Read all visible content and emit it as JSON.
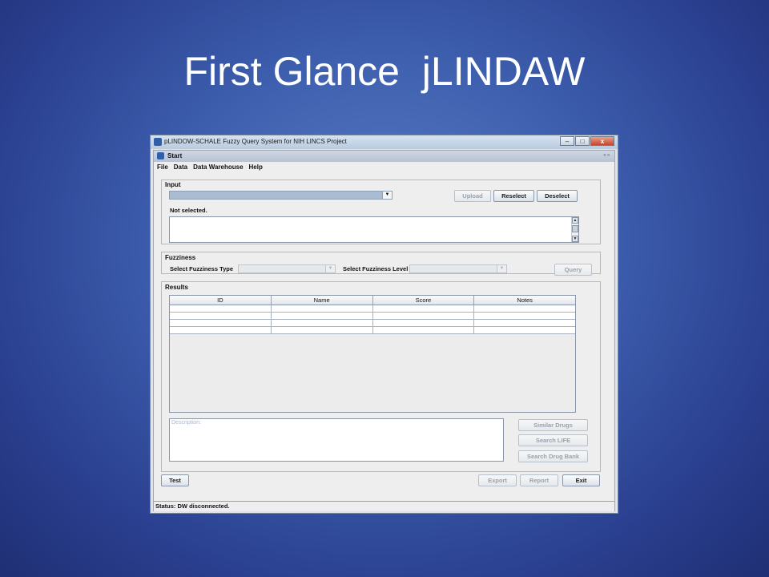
{
  "slide": {
    "title": "First Glance  jLINDAW"
  },
  "window": {
    "title": "pLINDOW-SCHALE Fuzzy Query System for NIH LINCS Project",
    "controls": {
      "minimize": "–",
      "maximize": "□",
      "close": "x"
    }
  },
  "internal_frame": {
    "title": "Start",
    "controls": "▫▫"
  },
  "menu": {
    "items": [
      "File",
      "Data",
      "Data Warehouse",
      "Help"
    ]
  },
  "input_panel": {
    "title": "Input",
    "combo_value": "",
    "status": "Not selected.",
    "buttons": {
      "upload": "Upload",
      "reselect": "Reselect",
      "deselect": "Deselect"
    }
  },
  "fuzziness_panel": {
    "title": "Fuzziness",
    "type_label": "Select Fuzziness Type",
    "level_label": "Select Fuzziness Level",
    "query_button": "Query"
  },
  "results_panel": {
    "title": "Results",
    "columns": [
      "ID",
      "Name",
      "Score",
      "Notes"
    ],
    "rows": [
      [
        "",
        "",
        "",
        ""
      ],
      [
        "",
        "",
        "",
        ""
      ],
      [
        "",
        "",
        "",
        ""
      ],
      [
        "",
        "",
        "",
        ""
      ]
    ],
    "description_placeholder": "Description:",
    "side_buttons": {
      "similar_drugs": "Similar Drugs",
      "search_life": "Search LIFE",
      "search_drug_bank": "Search Drug Bank"
    }
  },
  "bottom_buttons": {
    "test": "Test",
    "export": "Export",
    "report": "Report",
    "exit": "Exit"
  },
  "status_bar": {
    "text": "Status: DW disconnected."
  },
  "colors": {
    "slide_bg": "#3d5fae",
    "combo_selected_bg": "#a9bcd2",
    "accent": "#2f5fa8"
  }
}
